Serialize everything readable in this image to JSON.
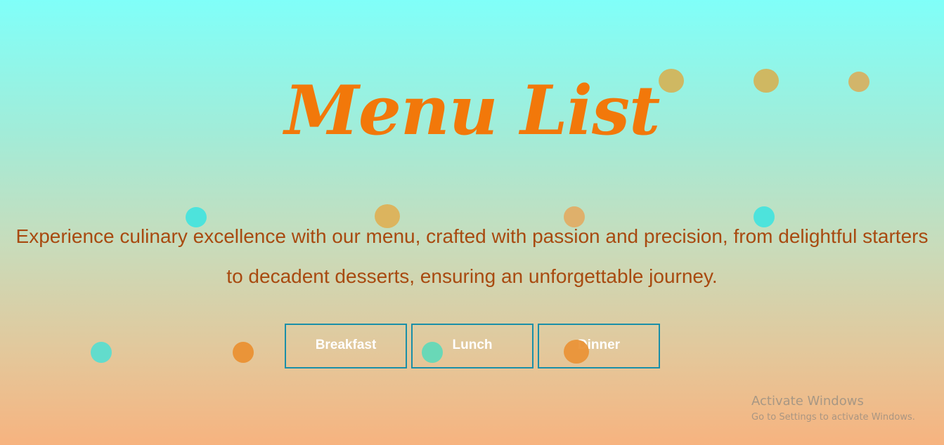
{
  "page": {
    "title": "Menu List",
    "description": "Experience culinary excellence with our menu, crafted with passion and precision, from delightful starters to decadent desserts, ensuring an unforgettable journey."
  },
  "menu_tabs": [
    {
      "label": "Breakfast"
    },
    {
      "label": "Lunch"
    },
    {
      "label": "Dinner"
    }
  ],
  "decorative_dots_colors": {
    "gold": "#d4b35a",
    "cyan": "#4de3dc",
    "orange": "#ea9438",
    "mint": "#62d9b8"
  },
  "watermark": {
    "title": "Activate Windows",
    "subtitle": "Go to Settings to activate Windows."
  },
  "colors": {
    "title": "#f2780a",
    "description": "#a84a10",
    "button_border": "#1a8fa8",
    "button_text": "#ffffff"
  }
}
